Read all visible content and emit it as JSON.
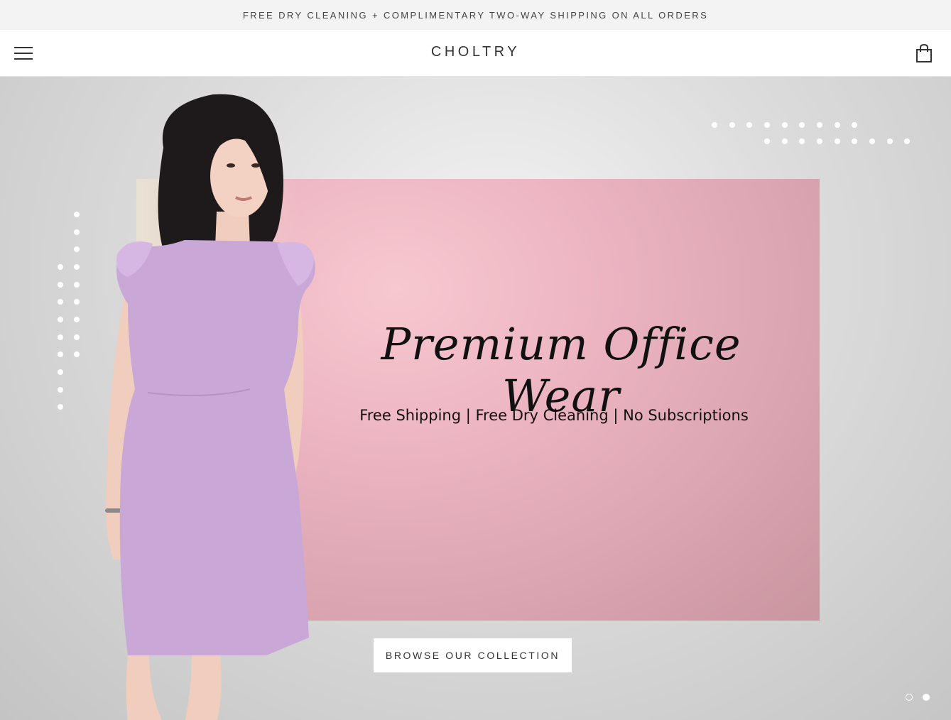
{
  "announcement": {
    "text": "FREE DRY CLEANING + COMPLIMENTARY TWO-WAY SHIPPING ON ALL ORDERS"
  },
  "header": {
    "brand": "CHOLTRY",
    "menu_icon": "hamburger-icon",
    "cart_icon": "shopping-bag-icon"
  },
  "hero": {
    "title": "Premium Office Wear",
    "subtitle": "Free Shipping | Free Dry Cleaning | No Subscriptions",
    "cta_label": "BROWSE OUR COLLECTION",
    "slides": {
      "count": 2,
      "active_index": 1
    }
  },
  "colors": {
    "announcement_bg": "#f3f3f3",
    "panel_pink": "#ecb4c1",
    "dress_lilac": "#c9a8d8",
    "hair": "#1e1a1c"
  }
}
